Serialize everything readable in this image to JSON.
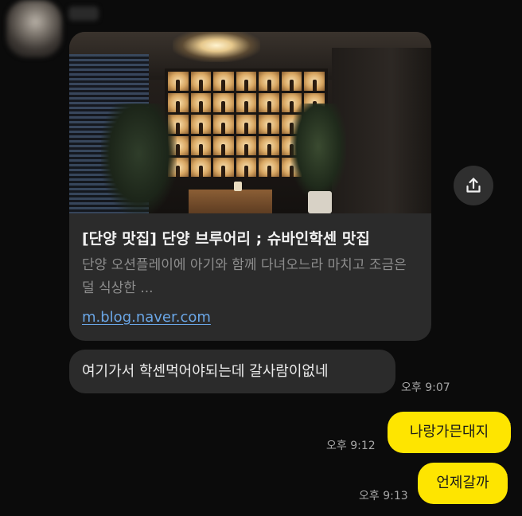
{
  "conversation": {
    "sender_name": "",
    "link_preview": {
      "title": "[단양 맛집] 단양 브루어리 ; 슈바인학센 맛집",
      "description": "단양 오션플레이에 아기와 함께 다녀오느라 마치고 조금은 덜 식상한 ...",
      "url": "m.blog.naver.com",
      "image_icon": "restaurant-photo"
    },
    "share_icon": "share-upload-icon",
    "messages": [
      {
        "side": "received",
        "text": "여기가서 학센먹어야되는데 갈사람이없네",
        "time": "오후 9:07"
      },
      {
        "side": "sent",
        "text": "나랑가믄대지",
        "time": "오후 9:12"
      },
      {
        "side": "sent",
        "text": "언제갈까",
        "time": "오후 9:13"
      }
    ]
  },
  "colors": {
    "background": "#0b0b0b",
    "received_bubble": "#2b2b2b",
    "sent_bubble": "#fee500",
    "link": "#6aa6e6",
    "timestamp": "#a6a6a6"
  }
}
